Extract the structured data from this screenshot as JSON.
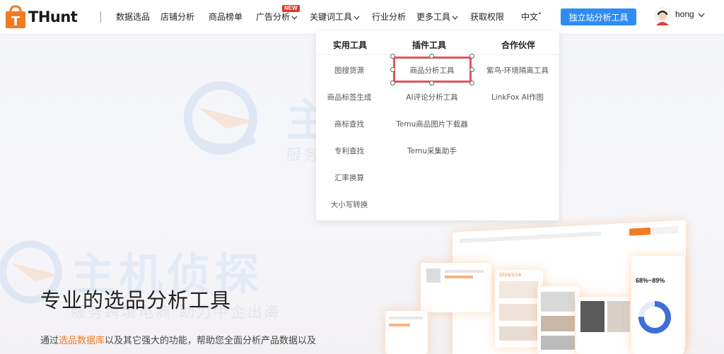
{
  "header": {
    "logo_text": "THunt",
    "nav": [
      {
        "label": "数据选品"
      },
      {
        "label": "店铺分析"
      },
      {
        "label": "商品榜单"
      },
      {
        "label": "广告分析"
      },
      {
        "label": "关键词工具"
      },
      {
        "label": "行业分析"
      },
      {
        "label": "更多工具"
      },
      {
        "label": "获取权限"
      }
    ],
    "new_badge": "NEW",
    "language": "中文",
    "cta_label": "独立站分析工具",
    "user_name": "hong"
  },
  "dropdown": {
    "columns": [
      {
        "title": "实用工具",
        "items": [
          "图搜货源",
          "商品标签生成",
          "商标查找",
          "专利查找",
          "汇率换算",
          "大小写转换"
        ]
      },
      {
        "title": "插件工具",
        "items": [
          "商品分析工具",
          "AI评论分析工具",
          "Temu商品图片下载器",
          "Temu采集助手"
        ]
      },
      {
        "title": "合作伙伴",
        "items": [
          "紫鸟-环境隔离工具",
          "LinkFox AI作图"
        ]
      }
    ],
    "selected_item": "商品分析工具"
  },
  "hero": {
    "title": "专业的选品分析工具",
    "desc_prefix": "通过",
    "desc_highlight": "选品数据库",
    "desc_suffix": "以及其它强大的功能，帮助您全面分析产品数据以及"
  },
  "watermark": {
    "main": "主机侦探",
    "sub": "服务跨境电商 助力中企出海"
  },
  "mock": {
    "stat_percent": "68%~89%",
    "date_label": "2024/3/14"
  },
  "colors": {
    "accent_blue": "#2f8df2",
    "accent_orange": "#f07b22",
    "badge_red": "#e4312b",
    "selection_red": "#e0545a"
  }
}
